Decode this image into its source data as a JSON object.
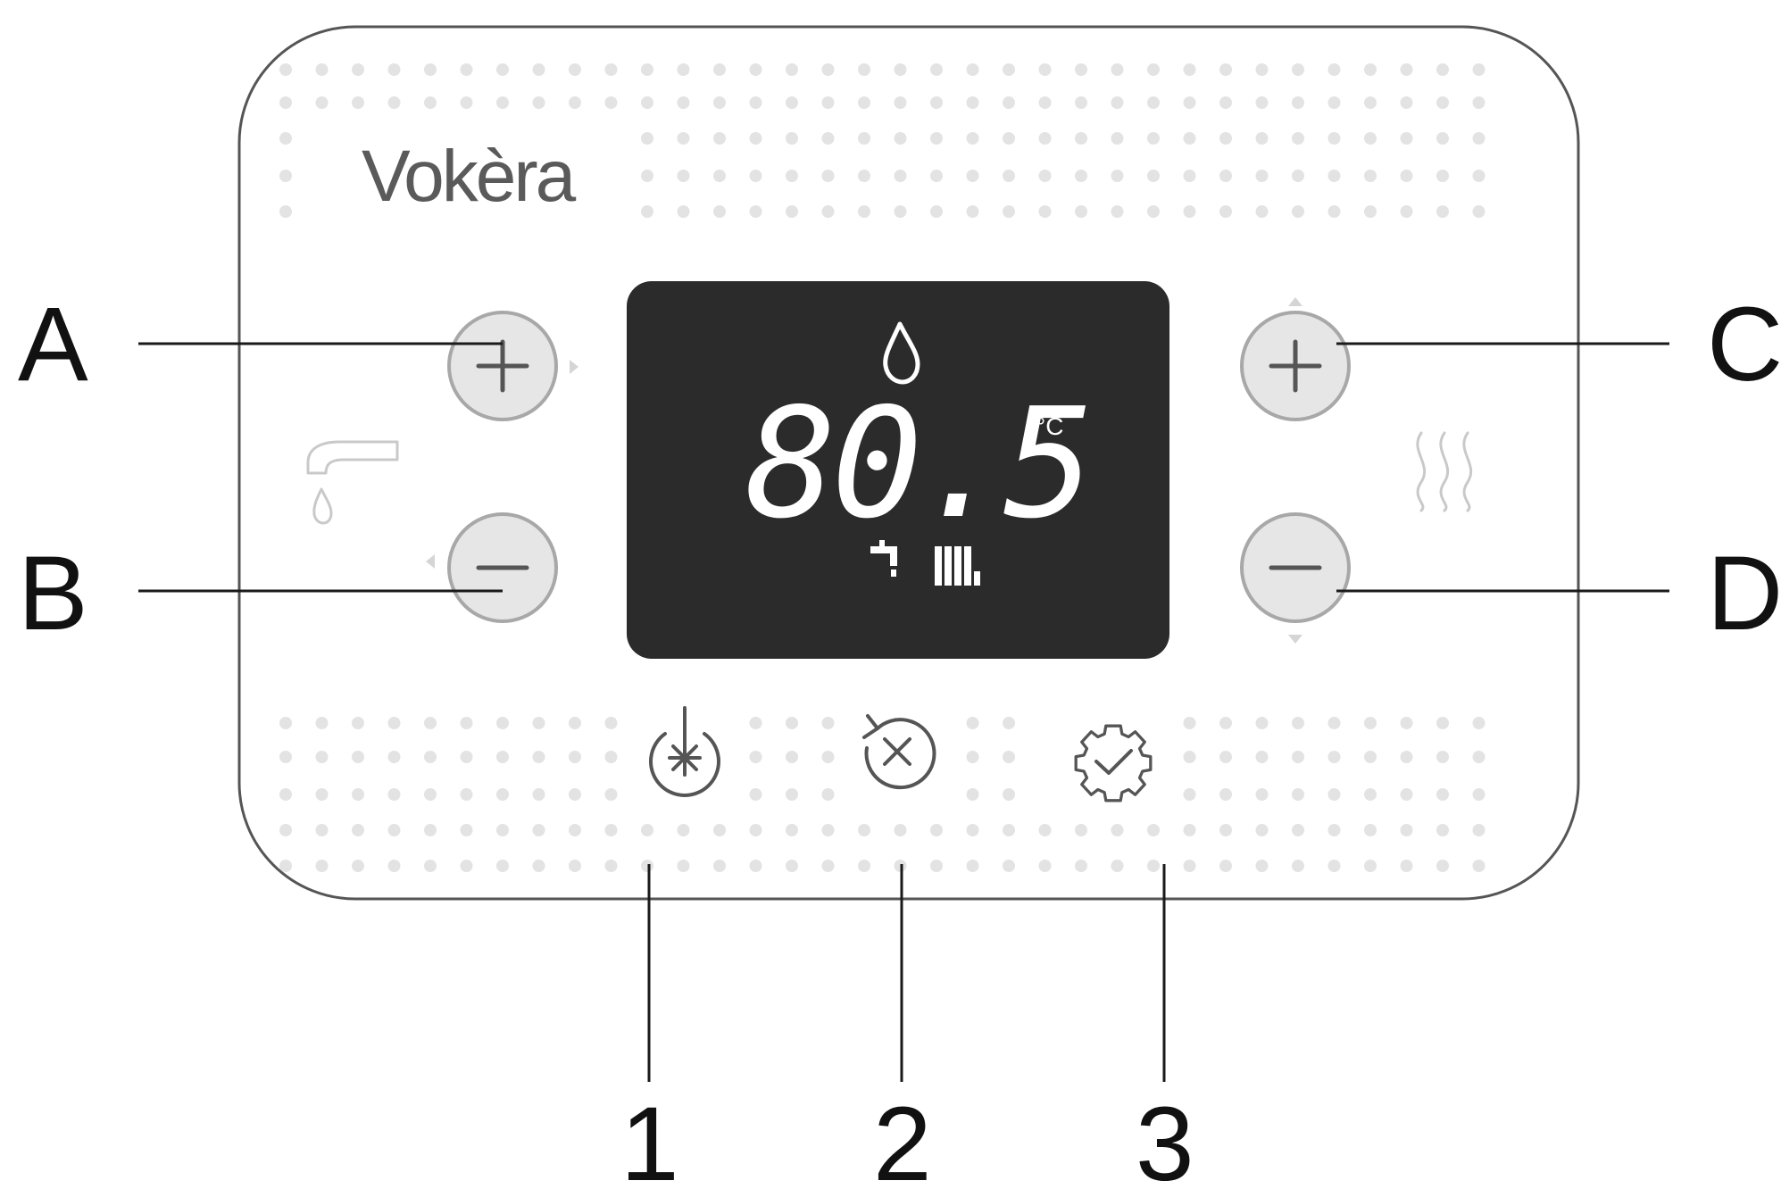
{
  "panel": {
    "brand": "Vokèra",
    "display": {
      "temperature": "80.5",
      "unit": "°C",
      "icons": [
        "flame-icon",
        "tap-icon",
        "radiator-icon"
      ]
    },
    "left_buttons": [
      {
        "symbol": "+",
        "icon": "plus-icon"
      },
      {
        "symbol": "−",
        "icon": "minus-icon"
      }
    ],
    "right_buttons": [
      {
        "symbol": "+",
        "icon": "plus-icon"
      },
      {
        "symbol": "−",
        "icon": "minus-icon"
      }
    ],
    "side_icons": {
      "left": "tap-outline-icon",
      "right": "heating-waves-icon"
    },
    "bottom_buttons": [
      {
        "icon": "power-frost-icon"
      },
      {
        "icon": "reset-icon"
      },
      {
        "icon": "settings-check-icon"
      }
    ]
  },
  "callouts": {
    "A": "A",
    "B": "B",
    "C": "C",
    "D": "D",
    "n1": "1",
    "n2": "2",
    "n3": "3"
  },
  "colors": {
    "panel_outline": "#555555",
    "dots": "#e3e3e3",
    "button_fill": "#e8e8e8",
    "button_ring": "#a8a8a8",
    "display_bg": "#2b2b2b",
    "display_text": "#ffffff",
    "brand_text": "#5a5a5a",
    "leader_line": "#1a1a1a"
  }
}
